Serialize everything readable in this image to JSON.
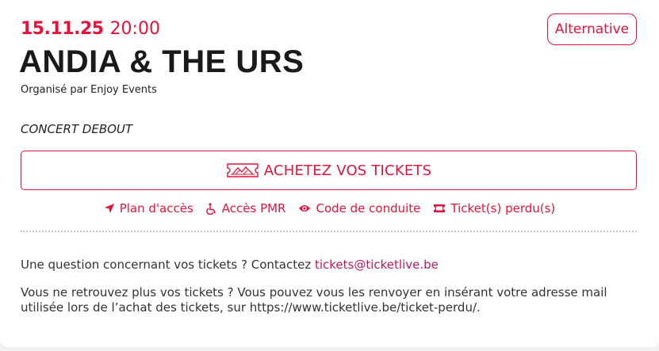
{
  "event": {
    "date": "15.11.25",
    "time": "20:00",
    "title": "ANDIA & THE URS",
    "organizer": "Organisé par Enjoy Events",
    "genre": "Alternative",
    "type": "CONCERT DEBOUT"
  },
  "buy_button": {
    "label": "ACHETEZ VOS TICKETS",
    "icon": "ticket-mountains-icon"
  },
  "links": [
    {
      "label": "Plan d'accès",
      "icon": "location-arrow-icon"
    },
    {
      "label": "Accès PMR",
      "icon": "wheelchair-icon"
    },
    {
      "label": "Code de conduite",
      "icon": "eye-icon"
    },
    {
      "label": "Ticket(s) perdu(s)",
      "icon": "ticket-icon"
    }
  ],
  "support": {
    "question_text": "Une question concernant vos tickets ? Contactez",
    "email": "tickets@ticketlive.be",
    "lost_text": "Vous ne retrouvez plus vos tickets ? Vous pouvez vous les renvoyer en insérant votre adresse mail utilisée lors de l’achat des tickets, sur https://www.ticketlive.be/ticket-perdu/."
  },
  "colors": {
    "accent": "#e4133a",
    "link": "#c2185b",
    "text": "#222222",
    "divider": "#c8c8c8"
  }
}
